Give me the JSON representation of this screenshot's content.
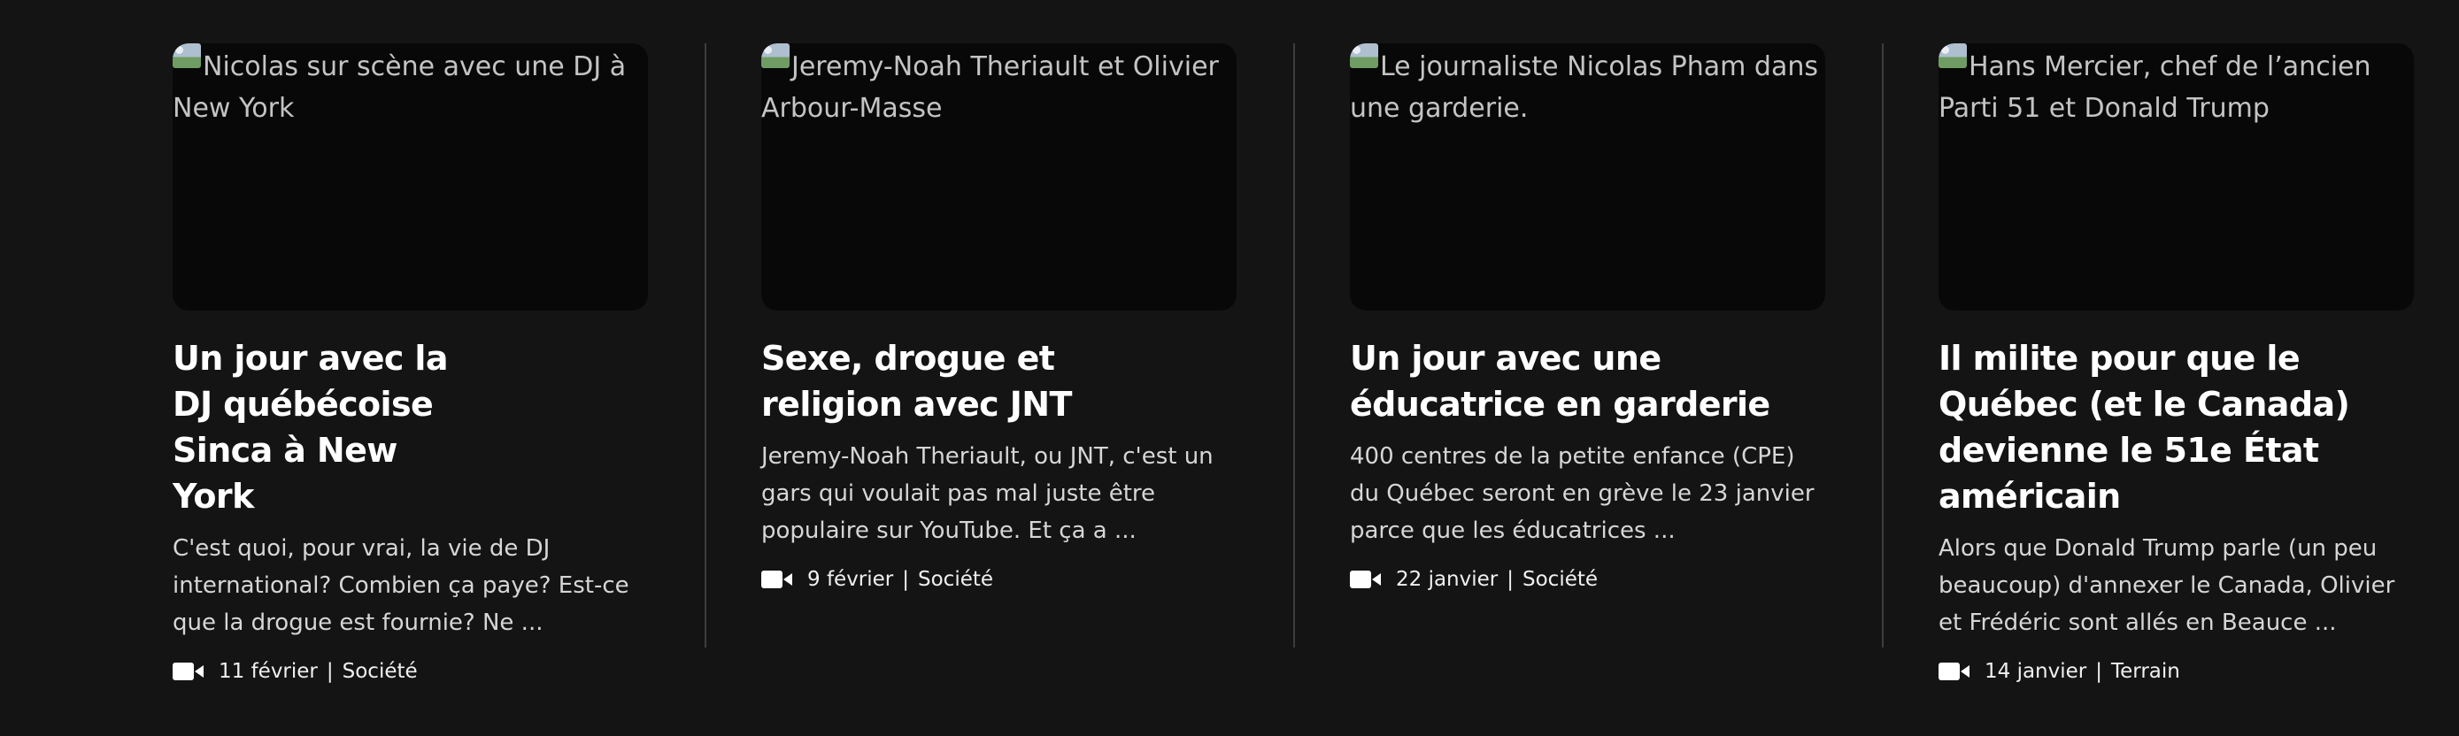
{
  "articles": [
    {
      "image_alt": "Nicolas sur scène avec une DJ à New York",
      "title": "Un jour avec la DJ québécoise Sinca à New York",
      "description": "C'est quoi, pour vrai, la vie de DJ international? Combien ça paye? Est-ce que la drogue est fournie? Ne ...",
      "media_icon": "video-camera-icon",
      "date": "11 février",
      "separator": "|",
      "category": "Société"
    },
    {
      "image_alt": "Jeremy-Noah Theriault et Olivier Arbour-Masse",
      "title": "Sexe, drogue et religion avec JNT",
      "description": "Jeremy-Noah Theriault, ou JNT, c'est un gars qui voulait pas mal juste être populaire sur YouTube. Et ça a ...",
      "media_icon": "video-camera-icon",
      "date": "9 février",
      "separator": "|",
      "category": "Société"
    },
    {
      "image_alt": "Le journaliste Nicolas Pham dans une garderie.",
      "title": "Un jour avec une éducatrice en garderie",
      "description": "400 centres de la petite enfance (CPE) du Québec seront en grève le 23 janvier parce que les éducatrices ...",
      "media_icon": "video-camera-icon",
      "date": "22 janvier",
      "separator": "|",
      "category": "Société"
    },
    {
      "image_alt": "Hans Mercier, chef de l’ancien Parti 51 et Donald Trump",
      "title": "Il milite pour que le Québec (et le Canada) devienne le 51e État américain",
      "description": "Alors que Donald Trump parle (un peu beaucoup) d'annexer le Canada, Olivier et Frédéric sont allés en Beauce ...",
      "media_icon": "video-camera-icon",
      "date": "14 janvier",
      "separator": "|",
      "category": "Terrain"
    }
  ],
  "colors": {
    "background": "#141414",
    "thumbnail": "#080808",
    "divider": "#3d3d3d",
    "title": "#ffffff",
    "description": "#d6d6d6",
    "alt_text": "#c4c4c4"
  }
}
